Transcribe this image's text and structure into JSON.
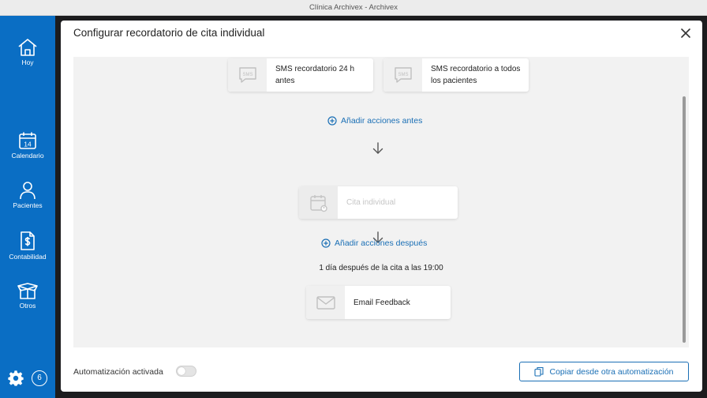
{
  "window": {
    "title": "Clínica Archivex - Archivex"
  },
  "sidebar": {
    "items": [
      {
        "label": "Hoy",
        "icon": "home-icon"
      },
      {
        "label": "Calendario",
        "icon": "calendar-icon",
        "day": "14"
      },
      {
        "label": "Pacientes",
        "icon": "person-icon"
      },
      {
        "label": "Contabilidad",
        "icon": "invoice-dollar-icon"
      },
      {
        "label": "Otros",
        "icon": "box-icon"
      }
    ],
    "settings_icon": "gear-icon",
    "badge": "6"
  },
  "modal": {
    "title": "Configurar recordatorio de cita individual",
    "before_actions": [
      {
        "label": "SMS recordatorio 24 h antes",
        "icon": "sms-icon"
      },
      {
        "label": "SMS recordatorio a todos los pacientes",
        "icon": "sms-icon"
      }
    ],
    "add_before_label": "Añadir acciones antes",
    "event": {
      "label": "Cita individual",
      "icon": "calendar-person-icon"
    },
    "add_after_label": "Añadir acciones después",
    "after_timing": "1 día después de la cita a las 19:00",
    "after_actions": [
      {
        "label": "Email Feedback",
        "icon": "envelope-icon"
      }
    ]
  },
  "footer": {
    "toggle_label": "Automatización activada",
    "toggle_on": false,
    "copy_button": "Copiar desde otra automatización"
  },
  "colors": {
    "accent": "#0a6ec4",
    "link": "#1a6fb5"
  }
}
